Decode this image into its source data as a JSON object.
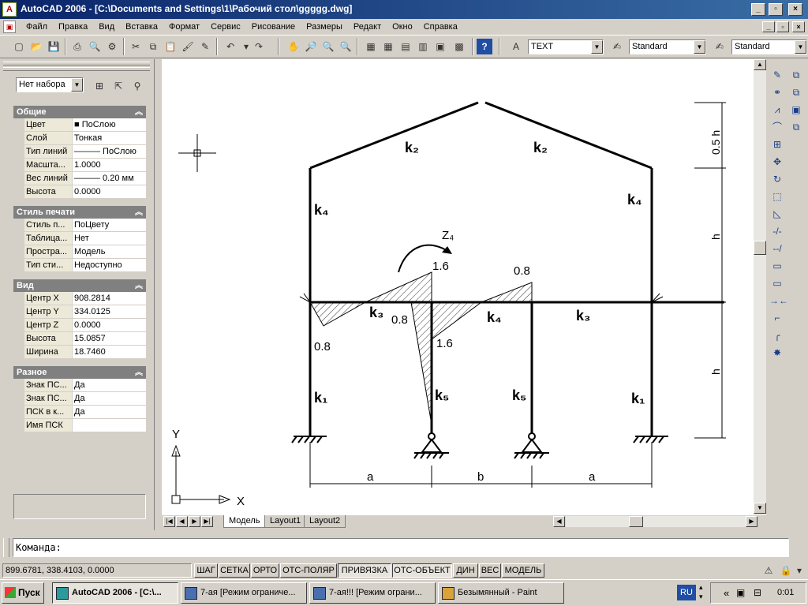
{
  "window": {
    "title": "AutoCAD 2006 - [C:\\Documents and Settings\\1\\Рабочий стол\\ggggg.dwg]",
    "app_icon_label": "A",
    "min_label": "_",
    "max_label": "▫",
    "close_label": "×"
  },
  "menu": [
    "Файл",
    "Правка",
    "Вид",
    "Вставка",
    "Формат",
    "Сервис",
    "Рисование",
    "Размеры",
    "Редакт",
    "Окно",
    "Справка"
  ],
  "toolbar": {
    "text_style": "TEXT",
    "dim_style": "Standard",
    "table_style": "Standard"
  },
  "properties": {
    "selection": "Нет набора",
    "sections": [
      {
        "title": "Общие",
        "rows": [
          {
            "name": "Цвет",
            "value": "■ ПоСлою"
          },
          {
            "name": "Слой",
            "value": "Тонкая"
          },
          {
            "name": "Тип линий",
            "value": "——— ПоСлою"
          },
          {
            "name": "Масшта...",
            "value": "1.0000"
          },
          {
            "name": "Вес линий",
            "value": "——— 0.20 мм"
          },
          {
            "name": "Высота",
            "value": "0.0000"
          }
        ]
      },
      {
        "title": "Стиль печати",
        "rows": [
          {
            "name": "Стиль п...",
            "value": "ПоЦвету"
          },
          {
            "name": "Таблица...",
            "value": "Нет"
          },
          {
            "name": "Простра...",
            "value": "Модель"
          },
          {
            "name": "Тип сти...",
            "value": "Недоступно"
          }
        ]
      },
      {
        "title": "Вид",
        "rows": [
          {
            "name": "Центр X",
            "value": "908.2814"
          },
          {
            "name": "Центр Y",
            "value": "334.0125"
          },
          {
            "name": "Центр Z",
            "value": "0.0000"
          },
          {
            "name": "Высота",
            "value": "15.0857"
          },
          {
            "name": "Ширина",
            "value": "18.7460"
          }
        ]
      },
      {
        "title": "Разное",
        "rows": [
          {
            "name": "Знак ПС...",
            "value": "Да"
          },
          {
            "name": "Знак ПС...",
            "value": "Да"
          },
          {
            "name": "ПСК в к...",
            "value": "Да"
          },
          {
            "name": "Имя ПСК",
            "value": ""
          }
        ]
      }
    ]
  },
  "drawing": {
    "labels": {
      "k2_left": "k₂",
      "k2_right": "k₂",
      "k4_left": "k₄",
      "k4_right": "k₄",
      "z4": "Z₄",
      "v16_top": "1.6",
      "v08_top": "0.8",
      "k3_left": "k₃",
      "k4_mid": "k₄",
      "k3_right": "k₃",
      "v08_a": "0.8",
      "v08_b": "0.8",
      "v16_b": "1.6",
      "k1_left": "k₁",
      "k5_a": "k₅",
      "k5_b": "k₅",
      "k1_right": "k₁",
      "dim_a1": "a",
      "dim_b": "b",
      "dim_a2": "a",
      "dim_05h": "0.5 h",
      "dim_h1": "h",
      "dim_h2": "h",
      "axis_x": "X",
      "axis_y": "Y"
    }
  },
  "layout_tabs": [
    "Модель",
    "Layout1",
    "Layout2"
  ],
  "command": {
    "prompt": "Команда:"
  },
  "status": {
    "coords": "899.6781, 338.4103, 0.0000",
    "buttons": [
      "ШАГ",
      "СЕТКА",
      "ОРТО",
      "ОТС-ПОЛЯР",
      "ПРИВЯЗКА",
      "ОТС-ОБЪЕКТ",
      "ДИН",
      "ВЕС",
      "МОДЕЛЬ"
    ]
  },
  "taskbar": {
    "start": "Пуск",
    "tasks": [
      "AutoCAD 2006 - [C:\\...",
      "7-ая [Режим ограниче...",
      "7-ая!!! [Режим ограни...",
      "Безымянный - Paint"
    ],
    "lang": "RU",
    "clock": "0:01",
    "chevron": "«"
  }
}
